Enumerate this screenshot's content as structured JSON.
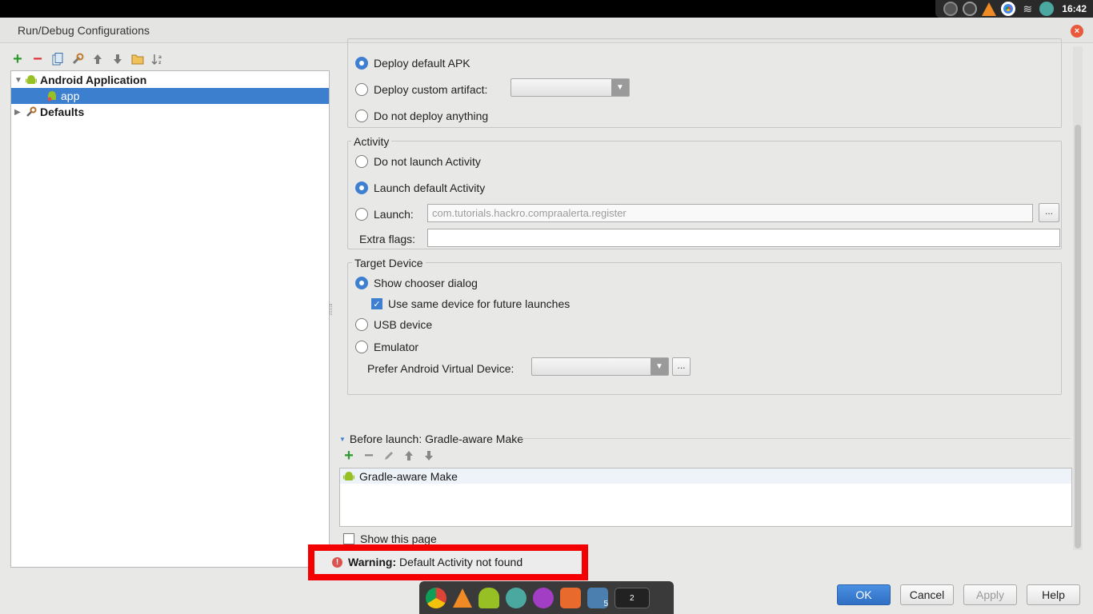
{
  "system_bar": {
    "clock": "16:42",
    "tray_icons": [
      "camera-icon",
      "steam-icon",
      "vlc-icon",
      "chrome-icon",
      "wifi-icon",
      "android-studio-icon"
    ]
  },
  "window": {
    "title": "Run/Debug Configurations",
    "close_label": "×"
  },
  "left_toolbar": {
    "icons": [
      "add-icon",
      "remove-icon",
      "copy-icon",
      "edit-defaults-icon",
      "move-up-icon",
      "move-down-icon",
      "folder-icon",
      "sort-icon"
    ]
  },
  "tree": {
    "android_application": "Android Application",
    "app": "app",
    "defaults": "Defaults"
  },
  "deploy": {
    "deploy_default_apk": "Deploy default APK",
    "deploy_custom_artifact": "Deploy custom artifact:",
    "do_not_deploy": "Do not deploy anything",
    "selected": "deploy_default_apk"
  },
  "activity": {
    "group_label": "Activity",
    "do_not_launch": "Do not launch Activity",
    "launch_default": "Launch default Activity",
    "launch": "Launch:",
    "launch_value": "com.tutorials.hackro.compraalerta.register",
    "extra_flags": "Extra flags:",
    "extra_flags_value": "",
    "ellipsis": "...",
    "selected": "launch_default"
  },
  "target_device": {
    "group_label": "Target Device",
    "show_chooser": "Show chooser dialog",
    "use_same_device": "Use same device for future launches",
    "use_same_device_checked": true,
    "usb_device": "USB device",
    "emulator": "Emulator",
    "prefer_avd": "Prefer Android Virtual Device:",
    "ellipsis": "...",
    "selected": "show_chooser"
  },
  "before_launch": {
    "header": "Before launch: Gradle-aware Make",
    "items": [
      "Gradle-aware Make"
    ],
    "show_this_page": "Show this page",
    "show_this_page_checked": false
  },
  "warning": {
    "label": "Warning:",
    "text": " Default Activity not found"
  },
  "buttons": {
    "ok": "OK",
    "cancel": "Cancel",
    "apply": "Apply",
    "help": "Help"
  },
  "dock": {
    "icons": [
      "chrome-icon",
      "vlc-icon",
      "android-icon",
      "android-studio-icon",
      "chat-icon",
      "app-store-icon",
      "files-icon",
      "workspace-icon"
    ],
    "badges": [
      "5",
      "2"
    ]
  },
  "colors": {
    "accent": "#3f7fd2",
    "selection": "#3d7fcf",
    "warning_border": "#f50000",
    "android_green": "#97c024"
  }
}
